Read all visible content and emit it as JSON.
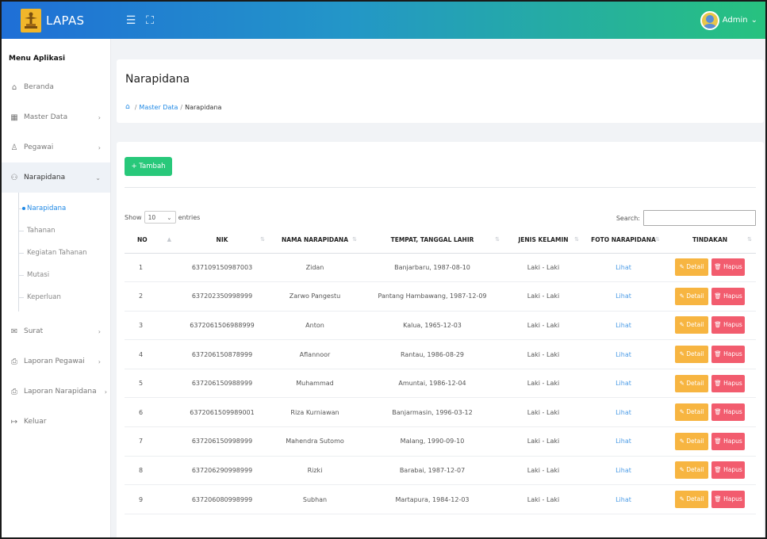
{
  "topbar": {
    "brand": "LAPAS",
    "menu_icon": "hamburger-icon",
    "fullscreen_icon": "expand-icon",
    "user_label": "Admin",
    "user_chevron": "⌄"
  },
  "sidebar": {
    "title": "Menu Aplikasi",
    "items": [
      {
        "label": "Beranda",
        "icon": "home-icon",
        "glyph": "⌂"
      },
      {
        "label": "Master Data",
        "icon": "grid-icon",
        "glyph": "▦",
        "chevron": "›"
      },
      {
        "label": "Pegawai",
        "icon": "user-icon",
        "glyph": "♙",
        "chevron": "›"
      },
      {
        "label": "Narapidana",
        "icon": "user-group-icon",
        "glyph": "⚇",
        "chevron": "⌄"
      },
      {
        "label": "Surat",
        "icon": "mail-icon",
        "glyph": "✉",
        "chevron": "›"
      },
      {
        "label": "Laporan Pegawai",
        "icon": "printer-icon",
        "glyph": "⎙",
        "chevron": "›"
      },
      {
        "label": "Laporan Narapidana",
        "icon": "printer-icon",
        "glyph": "⎙",
        "chevron": "›"
      },
      {
        "label": "Keluar",
        "icon": "logout-icon",
        "glyph": "↦"
      }
    ],
    "subitems": [
      "Narapidana",
      "Tahanan",
      "Kegiatan Tahanan",
      "Mutasi",
      "Keperluan"
    ]
  },
  "header": {
    "title": "Narapidana",
    "breadcrumb_link": "Master Data",
    "breadcrumb_current": "Narapidana"
  },
  "content": {
    "add_button": "+ Tambah",
    "show_label": "Show",
    "show_value": "10",
    "entries_label": "entries",
    "search_label": "Search:",
    "columns": [
      "NO",
      "NIK",
      "NAMA NARAPIDANA",
      "TEMPAT, TANGGAL LAHIR",
      "JENIS KELAMIN",
      "FOTO NARAPIDANA",
      "TINDAKAN"
    ],
    "detail_label": "Detail",
    "hapus_label": "Hapus",
    "rows": [
      {
        "no": "1",
        "nik": "637109150987003",
        "nama": "Zidan",
        "ttl": "Banjarbaru, 1987-08-10",
        "jk": "Laki - Laki",
        "foto": "Lihat"
      },
      {
        "no": "2",
        "nik": "637202350998999",
        "nama": "Zarwo Pangestu",
        "ttl": "Pantang Hambawang, 1987-12-09",
        "jk": "Laki - Laki",
        "foto": "Lihat"
      },
      {
        "no": "3",
        "nik": "6372061506988999",
        "nama": "Anton",
        "ttl": "Kalua, 1965-12-03",
        "jk": "Laki - Laki",
        "foto": "Lihat"
      },
      {
        "no": "4",
        "nik": "637206150878999",
        "nama": "Aflannoor",
        "ttl": "Rantau, 1986-08-29",
        "jk": "Laki - Laki",
        "foto": "Lihat"
      },
      {
        "no": "5",
        "nik": "637206150988999",
        "nama": "Muhammad",
        "ttl": "Amuntai, 1986-12-04",
        "jk": "Laki - Laki",
        "foto": "Lihat"
      },
      {
        "no": "6",
        "nik": "6372061509989001",
        "nama": "Riza Kurniawan",
        "ttl": "Banjarmasin, 1996-03-12",
        "jk": "Laki - Laki",
        "foto": "Lihat"
      },
      {
        "no": "7",
        "nik": "637206150998999",
        "nama": "Mahendra Sutomo",
        "ttl": "Malang, 1990-09-10",
        "jk": "Laki - Laki",
        "foto": "Lihat"
      },
      {
        "no": "8",
        "nik": "637206290998999",
        "nama": "Rizki",
        "ttl": "Barabai, 1987-12-07",
        "jk": "Laki - Laki",
        "foto": "Lihat"
      },
      {
        "no": "9",
        "nik": "637206080998999",
        "nama": "Subhan",
        "ttl": "Martapura, 1984-12-03",
        "jk": "Laki - Laki",
        "foto": "Lihat"
      }
    ]
  },
  "colors": {
    "topbar_start": "#1f6fd6",
    "topbar_end": "#27c27f",
    "add_button": "#28c87a",
    "detail_button": "#f7b541",
    "hapus_button": "#f25c6e",
    "link": "#1e88e5"
  }
}
